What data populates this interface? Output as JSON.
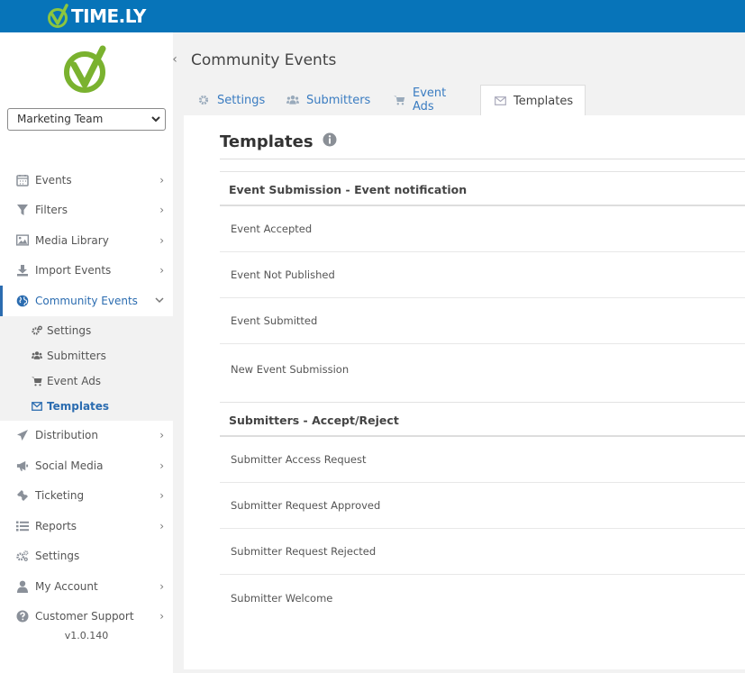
{
  "brand": {
    "name": "TIME.LY",
    "colors": {
      "topbar": "#0774b9",
      "logo_green": "#7ab22f",
      "accent": "#2b6cb0"
    }
  },
  "sidebar": {
    "team_select": {
      "value": "Marketing Team"
    },
    "items": [
      {
        "label": "Events",
        "icon": "calendar-icon",
        "has_arrow": true
      },
      {
        "label": "Filters",
        "icon": "filter-icon",
        "has_arrow": true
      },
      {
        "label": "Media Library",
        "icon": "image-icon",
        "has_arrow": true
      },
      {
        "label": "Import Events",
        "icon": "download-icon",
        "has_arrow": true
      },
      {
        "label": "Community Events",
        "icon": "globe-icon",
        "has_arrow": true,
        "active": true,
        "children": [
          {
            "label": "Settings",
            "icon": "cogs-icon"
          },
          {
            "label": "Submitters",
            "icon": "users-icon"
          },
          {
            "label": "Event Ads",
            "icon": "cart-icon"
          },
          {
            "label": "Templates",
            "icon": "envelope-icon",
            "active": true
          }
        ]
      },
      {
        "label": "Distribution",
        "icon": "paper-plane-icon",
        "has_arrow": true
      },
      {
        "label": "Social Media",
        "icon": "megaphone-icon",
        "has_arrow": true
      },
      {
        "label": "Ticketing",
        "icon": "ticket-icon",
        "has_arrow": true
      },
      {
        "label": "Reports",
        "icon": "list-icon",
        "has_arrow": true
      },
      {
        "label": "Settings",
        "icon": "gears-icon",
        "has_arrow": false
      },
      {
        "label": "My Account",
        "icon": "user-icon",
        "has_arrow": true
      },
      {
        "label": "Customer Support",
        "icon": "question-icon",
        "has_arrow": true
      }
    ],
    "version": "v1.0.140"
  },
  "header": {
    "title": "Community Events"
  },
  "tabs": [
    {
      "label": "Settings",
      "icon": "gear-icon"
    },
    {
      "label": "Submitters",
      "icon": "users-icon"
    },
    {
      "label": "Event Ads",
      "icon": "cart-icon"
    },
    {
      "label": "Templates",
      "icon": "envelope-icon",
      "active": true
    }
  ],
  "panel": {
    "title": "Templates",
    "sections": [
      {
        "heading": "Event Submission - Event notification",
        "rows": [
          "Event Accepted",
          "Event Not Published",
          "Event Submitted",
          "New Event Submission"
        ]
      },
      {
        "heading": "Submitters - Accept/Reject",
        "rows": [
          "Submitter Access Request",
          "Submitter Request Approved",
          "Submitter Request Rejected",
          "Submitter Welcome"
        ]
      }
    ]
  }
}
